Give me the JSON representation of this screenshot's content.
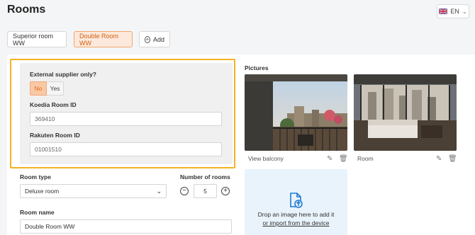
{
  "page": {
    "title": "Rooms"
  },
  "language": {
    "flag": "uk-flag-icon",
    "code": "EN"
  },
  "tabs": [
    {
      "label": "Superior room WW",
      "active": false
    },
    {
      "label": "Double Room WW",
      "active": true
    }
  ],
  "add_label": "Add",
  "supplier": {
    "external_label": "External supplier only?",
    "options": [
      "No",
      "Yes"
    ],
    "selected": "No",
    "koedia_label": "Koedia Room ID",
    "koedia_value": "369410",
    "rakuten_label": "Rakuten Room ID",
    "rakuten_value": "01001510"
  },
  "room": {
    "type_label": "Room type",
    "type_value": "Deluxe room",
    "count_label": "Number of rooms",
    "count_value": "5",
    "name_label": "Room name",
    "name_value": "Double Room WW"
  },
  "pictures": {
    "label": "Pictures",
    "items": [
      {
        "caption": "View balcony"
      },
      {
        "caption": "Room"
      }
    ],
    "drop_text": "Drop an image here to add it",
    "import_link": "or import from the device"
  },
  "colors": {
    "accent": "#f5b221",
    "active_tab_bg": "#fde9db",
    "active_tab_text": "#d25f13",
    "drop_bg": "#e9f3fb"
  }
}
